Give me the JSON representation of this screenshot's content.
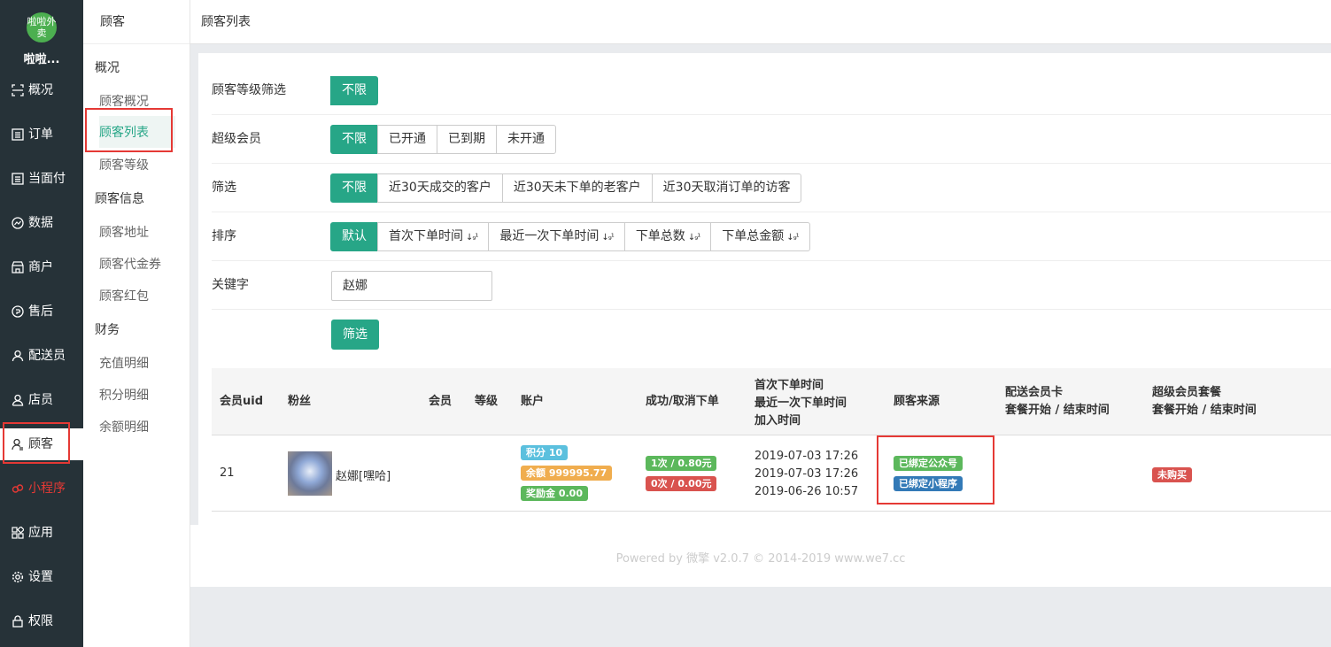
{
  "nav": {
    "logo_text": "啦啦外卖",
    "shop_name": "啦啦...",
    "items": [
      {
        "label": "概况",
        "icon": "scan-icon"
      },
      {
        "label": "订单",
        "icon": "list-icon"
      },
      {
        "label": "当面付",
        "icon": "list-icon"
      },
      {
        "label": "数据",
        "icon": "chart-icon"
      },
      {
        "label": "商户",
        "icon": "store-icon"
      },
      {
        "label": "售后",
        "icon": "aftersale-icon"
      },
      {
        "label": "配送员",
        "icon": "user-icon"
      },
      {
        "label": "店员",
        "icon": "user-icon"
      },
      {
        "label": "顾客",
        "icon": "user-icon"
      },
      {
        "label": "小程序",
        "icon": "miniprogram-icon"
      },
      {
        "label": "应用",
        "icon": "apps-icon"
      },
      {
        "label": "设置",
        "icon": "gear-icon"
      },
      {
        "label": "权限",
        "icon": "lock-icon"
      }
    ]
  },
  "sub": {
    "title": "顾客",
    "groups": [
      "概况",
      "顾客信息",
      "财务"
    ],
    "links": [
      "顾客概况",
      "顾客列表",
      "顾客等级",
      "顾客地址",
      "顾客代金券",
      "顾客红包",
      "充值明细",
      "积分明细",
      "余额明细"
    ]
  },
  "topbar": {
    "title": "顾客列表"
  },
  "filters": {
    "level": {
      "label": "顾客等级筛选",
      "options": [
        "不限"
      ]
    },
    "super": {
      "label": "超级会员",
      "options": [
        "不限",
        "已开通",
        "已到期",
        "未开通"
      ]
    },
    "filter": {
      "label": "筛选",
      "options": [
        "不限",
        "近30天成交的客户",
        "近30天未下单的老客户",
        "近30天取消订单的访客"
      ]
    },
    "sort": {
      "label": "排序",
      "options": [
        "默认",
        "首次下单时间",
        "最近一次下单时间",
        "下单总数",
        "下单总金额"
      ]
    },
    "keyword": {
      "label": "关键字",
      "value": "赵娜"
    },
    "submit": "筛选"
  },
  "table": {
    "headers": {
      "uid": "会员uid",
      "fans": "粉丝",
      "member": "会员",
      "level": "等级",
      "account": "账户",
      "orders": "成功/取消下单",
      "time1": "首次下单时间",
      "time2": "最近一次下单时间",
      "time3": "加入时间",
      "source": "顾客来源",
      "card1": "配送会员卡",
      "card2": "套餐开始 / 结束时间",
      "super1": "超级会员套餐",
      "super2": "套餐开始 / 结束时间"
    },
    "rows": [
      {
        "uid": "21",
        "name": "赵娜[嘿哈]",
        "points": "积分 10",
        "balance": "余额 999995.77",
        "bonus": "奖励金 0.00",
        "success": "1次 / 0.80元",
        "cancel": "0次 / 0.00元",
        "first": "2019-07-03 17:26",
        "last": "2019-07-03 17:26",
        "join": "2019-06-26 10:57",
        "src1": "已绑定公众号",
        "src2": "已绑定小程序",
        "super": "未购买"
      }
    ]
  },
  "footer": "Powered by 微擎 v2.0.7 © 2014-2019 www.we7.cc",
  "colors": {
    "primary": "#27a687",
    "nav_bg": "#263238",
    "highlight": "#e53935"
  }
}
